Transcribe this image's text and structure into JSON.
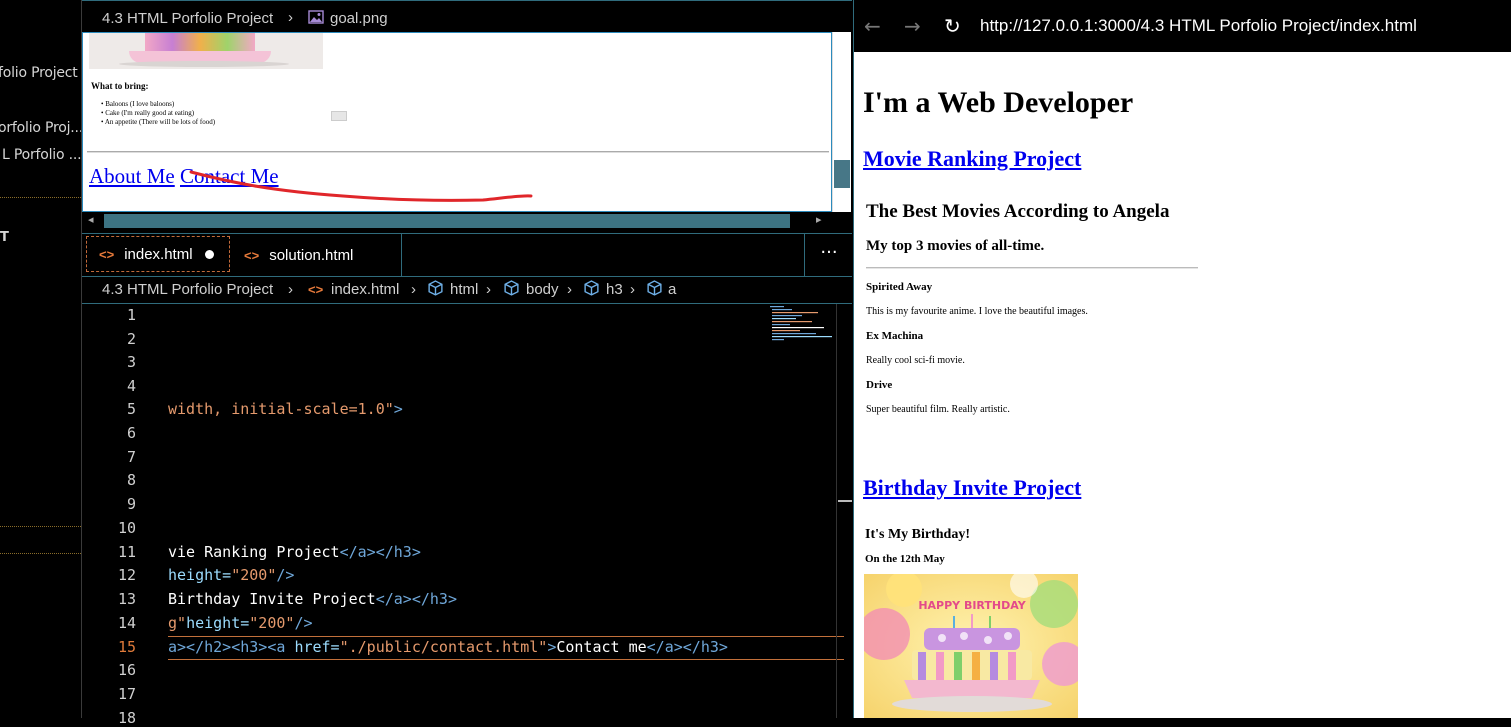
{
  "sidebar": {
    "items": [
      {
        "label": "folio Project"
      },
      {
        "label": "orfolio Proj..."
      },
      {
        "label": "L Porfolio ..."
      },
      {
        "label": "T"
      }
    ]
  },
  "top_editor": {
    "breadcrumb": {
      "folder": "4.3 HTML Porfolio Project",
      "file": "goal.png"
    },
    "preview": {
      "heading": "What to bring:",
      "list": [
        "Baloons (I love baloons)",
        "Cake (I'm really good at eating)",
        "An appetite (There will be lots of food)"
      ],
      "links": [
        "About Me",
        "Contact Me"
      ]
    }
  },
  "tabs": [
    {
      "label": "index.html",
      "active": true,
      "modified": true
    },
    {
      "label": "solution.html",
      "active": false
    }
  ],
  "tab_more": "···",
  "breadcrumb2": {
    "folder": "4.3 HTML Porfolio Project",
    "file": "index.html",
    "path": [
      "html",
      "body",
      "h3",
      "a"
    ]
  },
  "editor": {
    "line_numbers": [
      "1",
      "2",
      "3",
      "4",
      "5",
      "6",
      "7",
      "8",
      "9",
      "10",
      "11",
      "12",
      "13",
      "14",
      "15",
      "16",
      "17",
      "18"
    ],
    "active_line": "15",
    "lines": {
      "l5": "width, initial-scale=1.0\"",
      "l5_end": ">",
      "l11_text": "vie Ranking Project",
      "l11_tags": "</a></h3>",
      "l12_attr": "height=",
      "l12_val": "\"200\"",
      "l12_end": "/>",
      "l13_text": "Birthday Invite Project",
      "l13_tags": "</a></h3>",
      "l14_val": "g\"",
      "l14_attr": "height=",
      "l14_val2": "\"200\"",
      "l14_end": "/>",
      "l15_a": "a></h2><h3><a ",
      "l15_attr": "href=",
      "l15_val": "\"./public/contact.html\"",
      "l15_gt": ">",
      "l15_text": "Contact me",
      "l15_close": "</a></h3>"
    }
  },
  "browser": {
    "url": "http://127.0.0.1:3000/4.3 HTML Porfolio Project/index.html",
    "page": {
      "h1": "I'm a Web Developer",
      "link1": "Movie Ranking Project",
      "movies_title": "The Best Movies According to Angela",
      "movies_sub": "My top 3 movies of all-time.",
      "movies": [
        {
          "name": "Spirited Away",
          "desc": "This is my favourite anime. I love the beautiful images."
        },
        {
          "name": "Ex Machina",
          "desc": "Really cool sci-fi movie."
        },
        {
          "name": "Drive",
          "desc": "Super beautiful film. Really artistic."
        }
      ],
      "link2": "Birthday Invite Project",
      "bday_title": "It's My Birthday!",
      "bday_date": "On the 12th May",
      "cake_text": "HAPPY BIRTHDAY"
    }
  },
  "colors": {
    "link": "#0000ee",
    "accent_border": "#2f6b7c",
    "annotation": "#e0262a",
    "line_active": "#e07b3a"
  }
}
